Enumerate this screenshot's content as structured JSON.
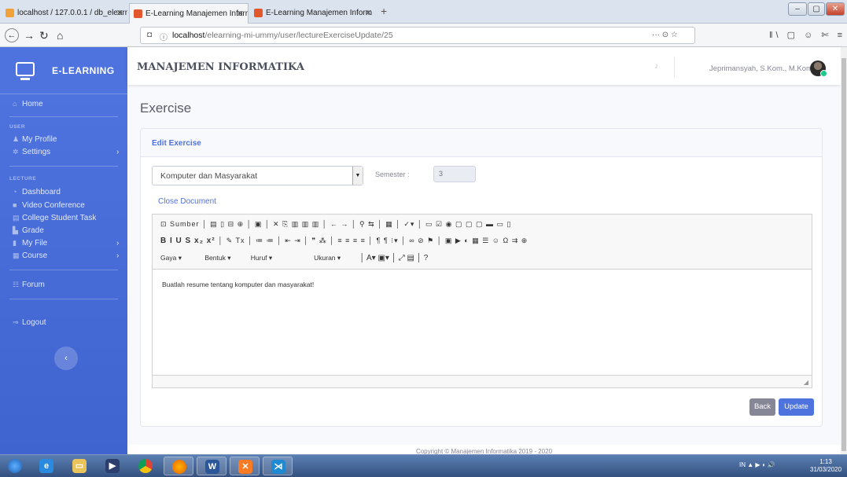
{
  "browser": {
    "tabs": [
      {
        "label": "localhost / 127.0.0.1 / db_elearn",
        "close": "✕"
      },
      {
        "label": "E-Learning Manajemen Inform",
        "close": "✕"
      },
      {
        "label": "E-Learning Manajemen Inform",
        "close": "✕"
      }
    ],
    "new_tab": "+",
    "url_host": "localhost",
    "url_path": "/elearning-mi-ummy/user/lectureExerciseUpdate/25",
    "page_actions": "··· ⊙ ☆",
    "right_icons": "ǁ\\ ▢ ☺ ✄ ≡"
  },
  "sidebar": {
    "brand": "E-LEARNING",
    "home": "Home",
    "section_user": "USER",
    "my_profile": "My Profile",
    "settings": "Settings",
    "section_lecture": "LECTURE",
    "dashboard": "Dashboard",
    "video_conference": "Video Conference",
    "college_student_task": "College Student Task",
    "grade": "Grade",
    "my_file": "My File",
    "course": "Course",
    "forum": "Forum",
    "logout": "Logout",
    "toggle": "‹"
  },
  "topbar": {
    "org_name": "MANAJEMEN INFORMATIKA",
    "user_name": "Jeprimansyah, S.Kom., M.Kom"
  },
  "page": {
    "title": "Exercise",
    "card_title": "Edit Exercise",
    "course_value": "Komputer dan Masyarakat",
    "semester_label": "Semester :",
    "semester_value": "3",
    "close_document": "Close Document",
    "editor_content": "Buatlah resume tentang komputer dan masyarakat!",
    "toolbar_row1": "⊡ Sumber │ ▤ ▯ ⊟ ⊕ │ ▣ │ ✕ ⎘ ▥ ▥ ▥ │ ← → │ ⚲ ⇆ │ ▦ │ ✓▾ │ ▭ ☑ ◉ ▢ ▢ ▢ ▬ ▭ ▯",
    "toolbar_row2_styles": "B I U S x₂ x²",
    "toolbar_row2_rest": "│ ✎ Tx │ ≔ ≔ │ ⇤ ⇥ │ ❞ ⁂ │ ≡ ≡ ≡ ≡ │ ¶ ¶ ⁝▾ │ ∞ ⊘ ⚑ │ ▣ ▶ ◐ ▦ ☰ ☺ Ω ⇉ ⊕",
    "toolbar_row3_styles": "Gaya",
    "toolbar_row3_format": "Bentuk",
    "toolbar_row3_font": "Huruf",
    "toolbar_row3_size": "Ukuran",
    "toolbar_row3_rest": "│ A▾ ▣▾ │ ⤢ ▤ │ ?",
    "back_button": "Back",
    "update_button": "Update",
    "footer": "Copyright © Manajemen Informatika 2019 - 2020"
  },
  "taskbar": {
    "tray": "IN ▲ ▶ ◗ 🔊",
    "time": "1:13",
    "date": "31/03/2020"
  },
  "colors": {
    "primary": "#4e73df",
    "secondary": "#858796",
    "success": "#1cc88a"
  }
}
